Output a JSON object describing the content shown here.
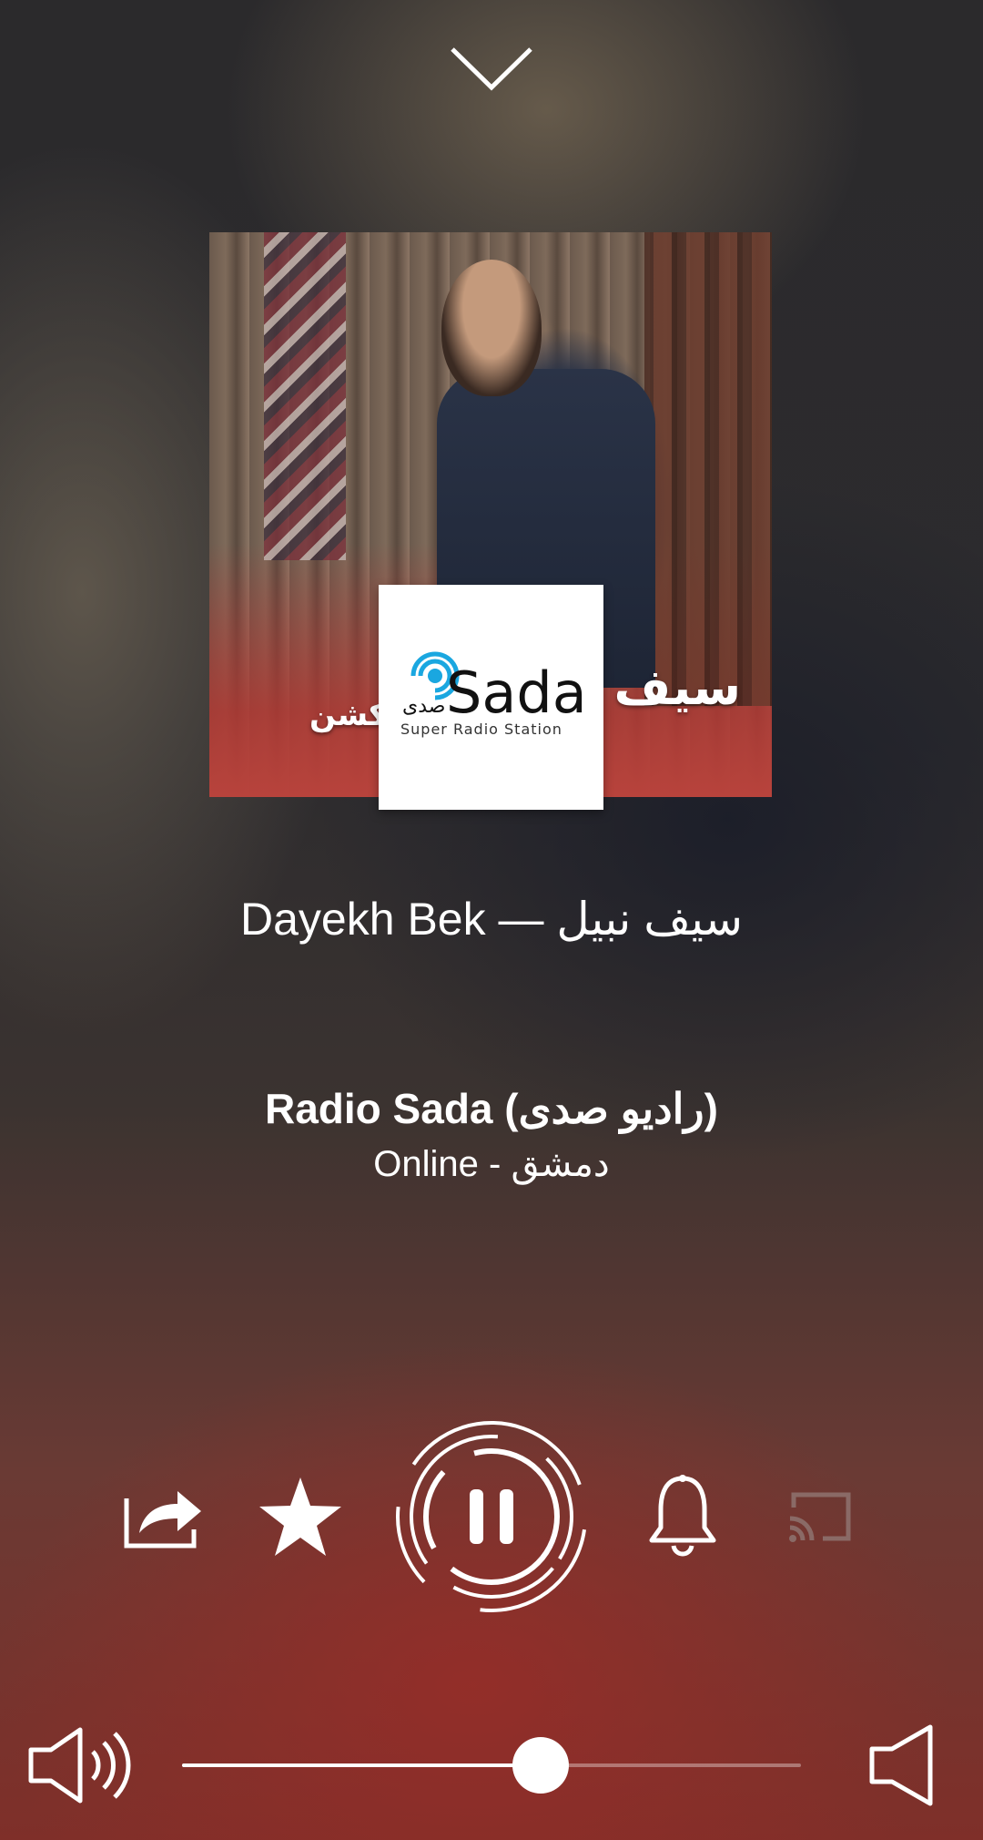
{
  "now_playing": {
    "song_title": "Dayekh Bek — سيف نبيل",
    "artwork_text_right": "سيف ن",
    "artwork_text_left": "كشن"
  },
  "station": {
    "name": "Radio Sada (راديو صدى)",
    "subtitle": "Online - دمشق",
    "logo_word": "Sada",
    "logo_arabic": "صدى",
    "logo_tagline": "Super Radio Station",
    "logo_accent": "#1aa7e0"
  },
  "controls": {
    "share": "share-icon",
    "favorite": "star-icon",
    "play_pause": "pause-icon",
    "alarm": "bell-icon",
    "cast": "cast-icon"
  },
  "volume": {
    "level": 0.58
  },
  "colors": {
    "foreground": "#ffffff",
    "cast_disabled": "#8a6a66"
  }
}
